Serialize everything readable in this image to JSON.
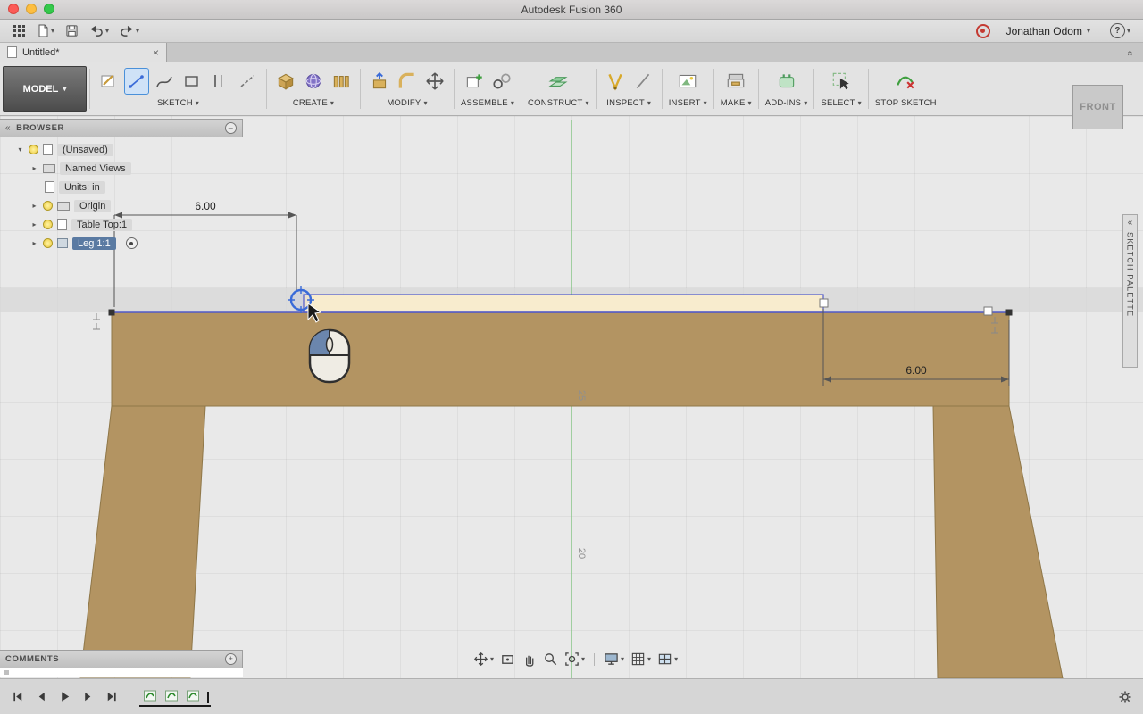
{
  "colors": {
    "wood": "#b39462",
    "wood_edge": "#8f7748",
    "highlight": "#f8ecce",
    "sketch_blue": "#5059c9",
    "axis_green": "#8bc88b",
    "selection_chip": "#5a7aa2",
    "record_red": "#c43a32",
    "active_tool_blue": "#4a90d9"
  },
  "titlebar": {
    "title": "Autodesk Fusion 360"
  },
  "appbar": {
    "user": "Jonathan Odom"
  },
  "tabbar": {
    "tab_title": "Untitled*"
  },
  "ribbon": {
    "model_label": "MODEL",
    "groups": [
      {
        "label": "SKETCH"
      },
      {
        "label": "CREATE"
      },
      {
        "label": "MODIFY"
      },
      {
        "label": "ASSEMBLE"
      },
      {
        "label": "CONSTRUCT"
      },
      {
        "label": "INSPECT"
      },
      {
        "label": "INSERT"
      },
      {
        "label": "MAKE"
      },
      {
        "label": "ADD-INS"
      },
      {
        "label": "SELECT"
      }
    ],
    "stop_sketch_label": "STOP SKETCH"
  },
  "viewcube": {
    "face": "FRONT"
  },
  "browser": {
    "title": "BROWSER",
    "items": [
      {
        "label": "(Unsaved)"
      },
      {
        "label": "Named Views"
      },
      {
        "label": "Units: in"
      },
      {
        "label": "Origin"
      },
      {
        "label": "Table Top:1"
      },
      {
        "label": "Leg 1:1"
      }
    ]
  },
  "sketch_palette": {
    "title": "SKETCH PALETTE"
  },
  "comments": {
    "title": "COMMENTS"
  },
  "canvas": {
    "dimension_top": "6.00",
    "dimension_right": "6.00",
    "axis_label_upper": "25",
    "axis_label_lower": "20"
  }
}
